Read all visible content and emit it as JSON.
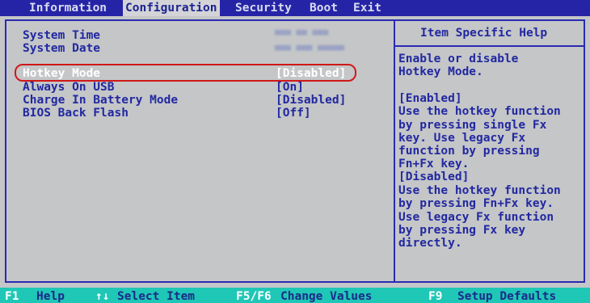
{
  "menu": [
    "Information",
    "Configuration",
    "Security",
    "Boot",
    "Exit"
  ],
  "active_menu": "Configuration",
  "settings": [
    {
      "label": "System Time",
      "value": ""
    },
    {
      "label": "System Date",
      "value": ""
    },
    {
      "label": "Hotkey Mode",
      "value": "[Disabled]"
    },
    {
      "label": "Always On USB",
      "value": "[On]"
    },
    {
      "label": "Charge In Battery Mode",
      "value": "[Disabled]"
    },
    {
      "label": "BIOS Back Flash",
      "value": "[Off]"
    }
  ],
  "selected_setting": "Hotkey Mode",
  "help": {
    "title": "Item Specific Help",
    "lines": [
      "Enable or disable",
      "Hotkey Mode.",
      "",
      "[Enabled]",
      "Use the hotkey function",
      "by pressing single Fx",
      "key. Use legacy Fx",
      "function by pressing",
      "Fn+Fx key.",
      "[Disabled]",
      "Use the hotkey function",
      "by pressing Fn+Fx key.",
      "Use legacy Fx function",
      "by pressing Fx key",
      "directly."
    ]
  },
  "footer": [
    {
      "key": "F1",
      "desc": "Help"
    },
    {
      "key": "↑↓",
      "desc": "Select Item"
    },
    {
      "key": "F5/F6",
      "desc": "Change Values"
    },
    {
      "key": "F9",
      "desc": "Setup Defaults"
    }
  ],
  "colors": {
    "menubar_bg": "#2624a6",
    "panel_bg": "#c4c6c8",
    "text_blue": "#2228a0",
    "footer_bg": "#1fc7b6",
    "highlight_ring": "#d01818"
  }
}
